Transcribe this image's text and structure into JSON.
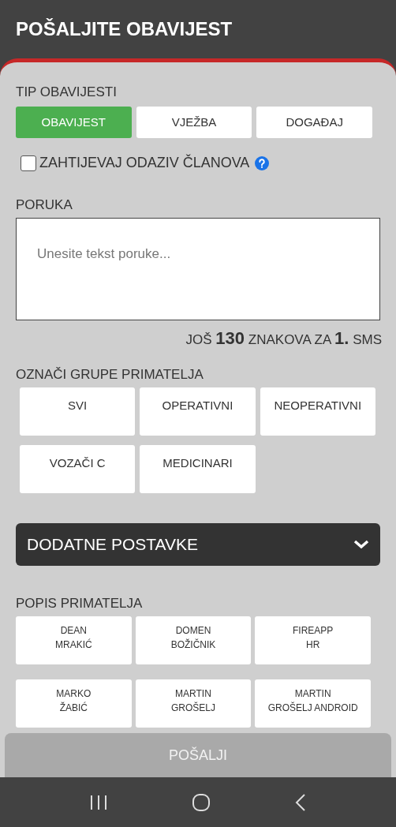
{
  "header": {
    "title": "POŠALJITE OBAVIJEST"
  },
  "type_section": {
    "label": "TIP OBAVIJESTI",
    "options": [
      {
        "label": "OBAVIJEST",
        "selected": true
      },
      {
        "label": "VJEŽBA",
        "selected": false
      },
      {
        "label": "DOGAĐAJ",
        "selected": false
      }
    ]
  },
  "response_checkbox": {
    "label": "ZAHTIJEVAJ ODAZIV ČLANOVA",
    "checked": false
  },
  "message": {
    "label": "PORUKA",
    "placeholder": "Unesite tekst poruke...",
    "counter": "JOŠ **130** ZNAKOVA ZA **1.** SMS"
  },
  "groups": {
    "label": "OZNAČI GRUPE PRIMATELJA",
    "items": [
      {
        "label": "SVI",
        "selected": false
      },
      {
        "label": "OPERATIVNI",
        "selected": false
      },
      {
        "label": "NEOPERATIVNI",
        "selected": false
      },
      {
        "label": "VOZAČI C",
        "selected": false
      },
      {
        "label": "MEDICINARI",
        "selected": false
      }
    ]
  },
  "extra_settings": {
    "label": "DODATNE POSTAVKE",
    "expanded": false
  },
  "recipients": {
    "label": "POPIS PRIMATELJA",
    "items": [
      {
        "lines": [
          "DEAN",
          "MRAKIĆ"
        ],
        "selected": false
      },
      {
        "lines": [
          "DOMEN",
          "BOŽIČNIK"
        ],
        "selected": false
      },
      {
        "lines": [
          "FIREAPP",
          "HR"
        ],
        "selected": false
      },
      {
        "lines": [
          "MARKO",
          "ŽABIĆ"
        ],
        "selected": false
      },
      {
        "lines": [
          "MARTIN",
          "GROŠELJ"
        ],
        "selected": false
      },
      {
        "lines": [
          "MARTIN",
          "GROŠELJ ANDROID"
        ],
        "selected": false
      }
    ]
  },
  "send_button": {
    "label": "POŠALJI",
    "disabled": true
  }
}
